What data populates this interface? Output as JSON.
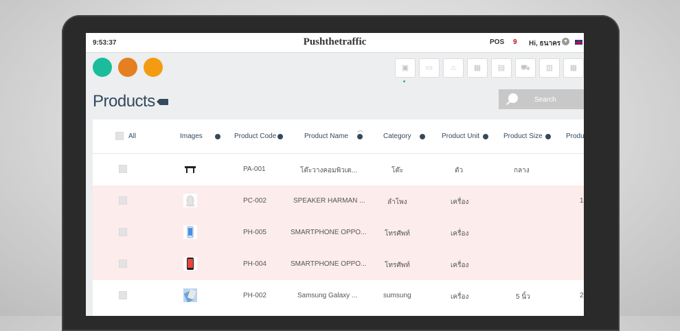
{
  "topbar": {
    "clock": "9:53:37",
    "brand": "Pushthetraffic",
    "pos_label": "POS",
    "pos_count": "9",
    "greeting": "Hi, ธนาคร"
  },
  "colors": {
    "teal": "#1abc9c",
    "orange": "#e67e22",
    "amber": "#f39c12",
    "accent": "#34495e"
  },
  "toolbar_icons": [
    "box-icon",
    "card-icon",
    "delivery-icon",
    "calendar-icon",
    "document-icon",
    "cart-icon",
    "columns-icon",
    "grid-icon"
  ],
  "page": {
    "title": "Products"
  },
  "search": {
    "label": "Search"
  },
  "table": {
    "columns": [
      "All",
      "Images",
      "Product Code",
      "Product Name",
      "Category",
      "Product Unit",
      "Product Size",
      "Produ"
    ],
    "rows": [
      {
        "code": "PA-001",
        "name": "โต๊ะวางคอมพิวเต...",
        "category": "โต๊ะ",
        "unit": "ตัว",
        "size": "กลาง",
        "extra": "",
        "image": "desk-image"
      },
      {
        "code": "PC-002",
        "name": "SPEAKER HARMAN ...",
        "category": "ลำโพง",
        "unit": "เครื่อง",
        "size": "",
        "extra": "1",
        "image": "speaker-image"
      },
      {
        "code": "PH-005",
        "name": "SMARTPHONE OPPO...",
        "category": "โทรศัพท์",
        "unit": "เครื่อง",
        "size": "",
        "extra": "",
        "image": "phone-image"
      },
      {
        "code": "PH-004",
        "name": "SMARTPHONE OPPO...",
        "category": "โทรศัพท์",
        "unit": "เครื่อง",
        "size": "",
        "extra": "",
        "image": "phone-image"
      },
      {
        "code": "PH-002",
        "name": "Samsung Galaxy ...",
        "category": "sumsung",
        "unit": "เครื่อง",
        "size": "5 นิ้ว",
        "extra": "2",
        "image": "phone-image"
      }
    ]
  }
}
